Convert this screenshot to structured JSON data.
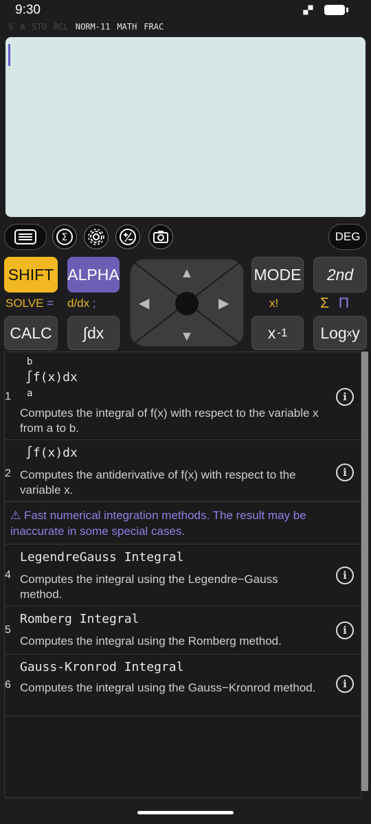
{
  "status": {
    "time": "9:30"
  },
  "indicators": {
    "dim": [
      "S",
      "A",
      "STO",
      "RCL"
    ],
    "active": [
      "NORM-11",
      "MATH",
      "FRAC"
    ]
  },
  "toolbar": {
    "icons": [
      "menu-icon",
      "sigma-icon",
      "gear-icon",
      "plus-minus-icon",
      "camera-icon"
    ],
    "angle_mode": "DEG"
  },
  "keys": {
    "shift": "SHIFT",
    "alpha": "ALPHA",
    "mode": "MODE",
    "second": "2nd",
    "calc": "CALC",
    "integral": "∫dx",
    "inverse_base": "x",
    "inverse_exp": "-1",
    "log_main": "Log",
    "log_sub": "x",
    "log_end": "y"
  },
  "sublabels": {
    "solve": "SOLVE",
    "equals": "=",
    "ddx": "d/dx",
    "semicolon": ";",
    "factorial": "x!",
    "sigma": "Σ",
    "product": "Π"
  },
  "list": {
    "items": [
      {
        "num": "1",
        "upper": "b",
        "formula": "∫f(x)dx",
        "lower": "a",
        "desc": "Computes the integral of f(x) with respect to the variable x from a to b."
      },
      {
        "num": "2",
        "formula": "∫f(x)dx",
        "desc": "Computes the antiderivative of f(x) with respect to the variable x."
      },
      {
        "warning": "⚠ Fast numerical integration methods. The result may be inaccurate in some special cases."
      },
      {
        "num": "4",
        "title": "LegendreGauss Integral",
        "desc": "Computes the integral using the Legendre−Gauss method."
      },
      {
        "num": "5",
        "title": "Romberg Integral",
        "desc": "Computes the integral using the Romberg method."
      },
      {
        "num": "6",
        "title": "Gauss-Kronrod Integral",
        "desc": "Computes the integral using the Gauss−Kronrod method."
      }
    ]
  },
  "colors": {
    "shift": "#f1b821",
    "alpha": "#6b5fb5",
    "display": "#d6e7e5",
    "accent_purple": "#8d82e6"
  }
}
